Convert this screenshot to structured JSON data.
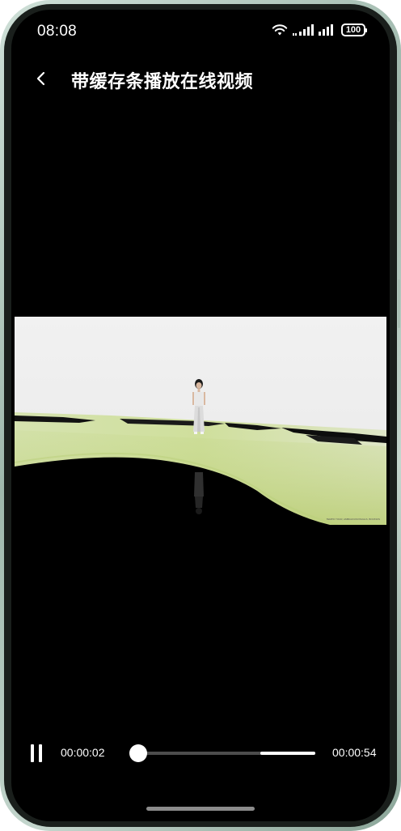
{
  "status_bar": {
    "time": "08:08",
    "battery": "100",
    "icons": [
      "wifi-icon",
      "signal-icon",
      "signal-icon",
      "battery-icon"
    ]
  },
  "header": {
    "back_icon": "chevron-left-icon",
    "title": "带缓存条播放在线视频"
  },
  "video": {
    "caption": "TEMPO TOUR, AMBIGIOUSVISUALS, BOVINOS"
  },
  "player": {
    "state": "playing",
    "pause_icon": "pause-icon",
    "current_time": "00:00:02",
    "total_time": "00:00:54",
    "played_fraction": 0.037,
    "buffered_fraction": 0.7
  },
  "colors": {
    "background": "#000000",
    "text": "#ffffff",
    "track": "#4d4d4d",
    "buffer": "#ffffff",
    "frame": "#a9bfb4"
  }
}
